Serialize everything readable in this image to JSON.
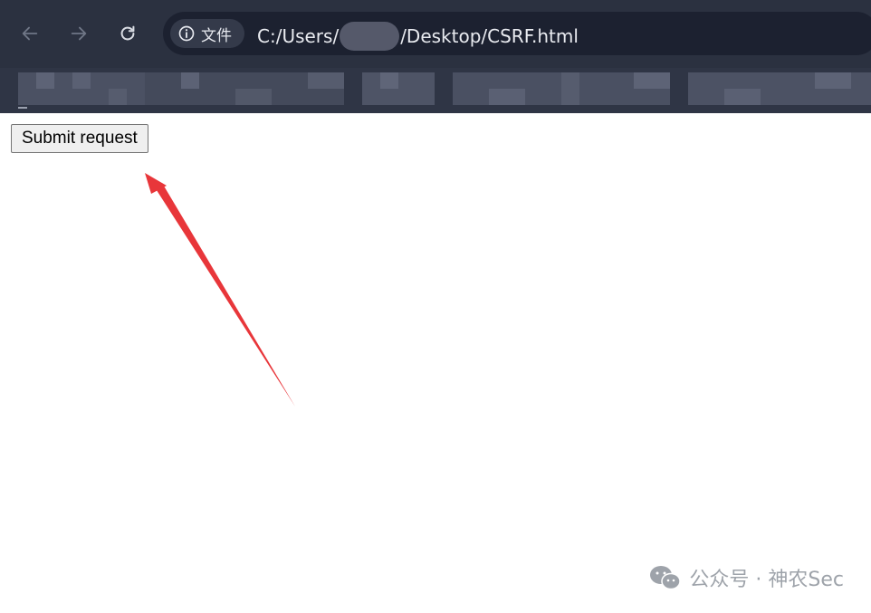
{
  "browser": {
    "site_chip_label": "文件",
    "url_prefix": "C:/Users/",
    "url_suffix": "/Desktop/CSRF.html"
  },
  "page": {
    "submit_button_label": "Submit request"
  },
  "watermark": {
    "text": "公众号 · 神农Sec"
  },
  "colors": {
    "toolbar": "#2b3140",
    "omnibox": "#1c2130",
    "annotation_arrow": "#e8363a"
  }
}
